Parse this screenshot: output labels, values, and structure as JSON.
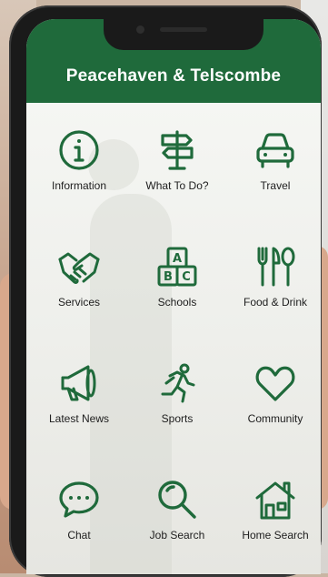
{
  "app": {
    "title": "Peacehaven & Telscombe",
    "header_color": "#1f6a3b",
    "icon_color": "#1f6a3b"
  },
  "menu": [
    {
      "label": "Information",
      "icon": "info-icon"
    },
    {
      "label": "What To Do?",
      "icon": "signpost-icon"
    },
    {
      "label": "Travel",
      "icon": "car-icon"
    },
    {
      "label": "Services",
      "icon": "handshake-icon"
    },
    {
      "label": "Schools",
      "icon": "abc-blocks-icon"
    },
    {
      "label": "Food & Drink",
      "icon": "fork-knife-icon"
    },
    {
      "label": "Latest News",
      "icon": "megaphone-icon"
    },
    {
      "label": "Sports",
      "icon": "running-person-icon"
    },
    {
      "label": "Community",
      "icon": "heart-icon"
    },
    {
      "label": "Chat",
      "icon": "chat-bubble-icon"
    },
    {
      "label": "Job Search",
      "icon": "magnifier-icon"
    },
    {
      "label": "Home Search",
      "icon": "house-icon"
    }
  ]
}
